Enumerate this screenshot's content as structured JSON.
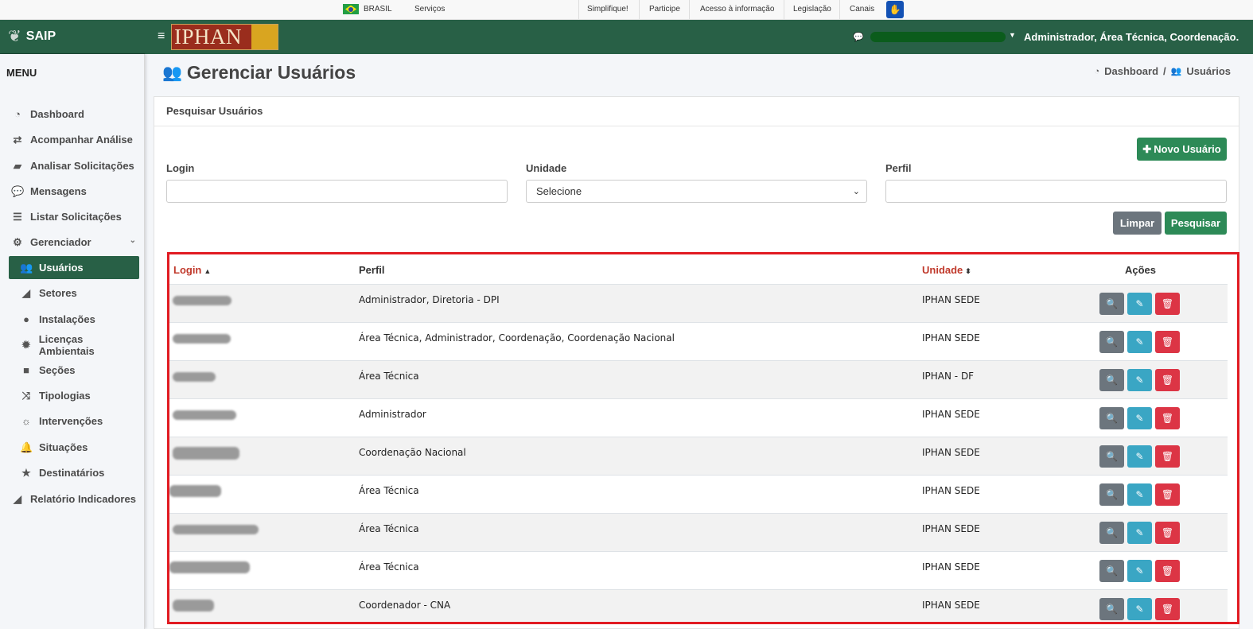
{
  "gov_bar": {
    "country": "BRASIL",
    "links": [
      "Serviços",
      "Simplifique!",
      "Participe",
      "Acesso à informação",
      "Legislação",
      "Canais"
    ]
  },
  "brand": {
    "name": "SAIP"
  },
  "header": {
    "logo_text": "IPHAN",
    "user_roles": "Administrador, Área Técnica, Coordenação..."
  },
  "sidebar": {
    "title": "MENU",
    "items": [
      {
        "label": "Dashboard",
        "icon": "dashboard-icon"
      },
      {
        "label": "Acompanhar Análise",
        "icon": "exchange-icon"
      },
      {
        "label": "Analisar Solicitações",
        "icon": "book-icon"
      },
      {
        "label": "Mensagens",
        "icon": "comments-icon"
      },
      {
        "label": "Listar Solicitações",
        "icon": "list-icon"
      },
      {
        "label": "Gerenciador",
        "icon": "cogs-icon"
      },
      {
        "label": "Usuários",
        "icon": "users-icon"
      },
      {
        "label": "Setores",
        "icon": "area-chart-icon"
      },
      {
        "label": "Instalações",
        "icon": "circle-icon"
      },
      {
        "label": "Licenças Ambientais",
        "icon": "certificate-icon"
      },
      {
        "label": "Seções",
        "icon": "square-icon"
      },
      {
        "label": "Tipologias",
        "icon": "random-icon"
      },
      {
        "label": "Intervenções",
        "icon": "sun-icon"
      },
      {
        "label": "Situações",
        "icon": "bell-icon"
      },
      {
        "label": "Destinatários",
        "icon": "star-icon"
      },
      {
        "label": "Relatório Indicadores",
        "icon": "area-chart-icon"
      }
    ]
  },
  "page": {
    "title": "Gerenciar Usuários",
    "breadcrumb": [
      "Dashboard",
      "/",
      "Usuários"
    ]
  },
  "search": {
    "card_title": "Pesquisar Usuários",
    "new_user_label": "Novo Usuário",
    "login_label": "Login",
    "login_value": "",
    "unidade_label": "Unidade",
    "unidade_selected": "Selecione",
    "perfil_label": "Perfil",
    "perfil_value": "",
    "clear_label": "Limpar",
    "search_label": "Pesquisar"
  },
  "table": {
    "headers": {
      "login": "Login",
      "perfil": "Perfil",
      "unidade": "Unidade",
      "acoes": "Ações"
    },
    "rows": [
      {
        "perfil": "Administrador, Diretoria - DPI",
        "unidade": "IPHAN SEDE"
      },
      {
        "perfil": "Área Técnica, Administrador, Coordenação, Coordenação Nacional",
        "unidade": "IPHAN SEDE"
      },
      {
        "perfil": "Área Técnica",
        "unidade": "IPHAN - DF"
      },
      {
        "perfil": "Administrador",
        "unidade": "IPHAN SEDE"
      },
      {
        "perfil": "Coordenação Nacional",
        "unidade": "IPHAN SEDE"
      },
      {
        "perfil": "Área Técnica",
        "unidade": "IPHAN SEDE"
      },
      {
        "perfil": "Área Técnica",
        "unidade": "IPHAN SEDE"
      },
      {
        "perfil": "Área Técnica",
        "unidade": "IPHAN SEDE"
      },
      {
        "perfil": "Coordenador - CNA",
        "unidade": "IPHAN SEDE"
      }
    ]
  },
  "colors": {
    "primary_green": "#286046",
    "button_green": "#2d8a57",
    "highlight_border": "#e11b22",
    "sort_header": "#c0392b",
    "edit_button": "#3aa6c4",
    "delete_button": "#dc3545"
  }
}
